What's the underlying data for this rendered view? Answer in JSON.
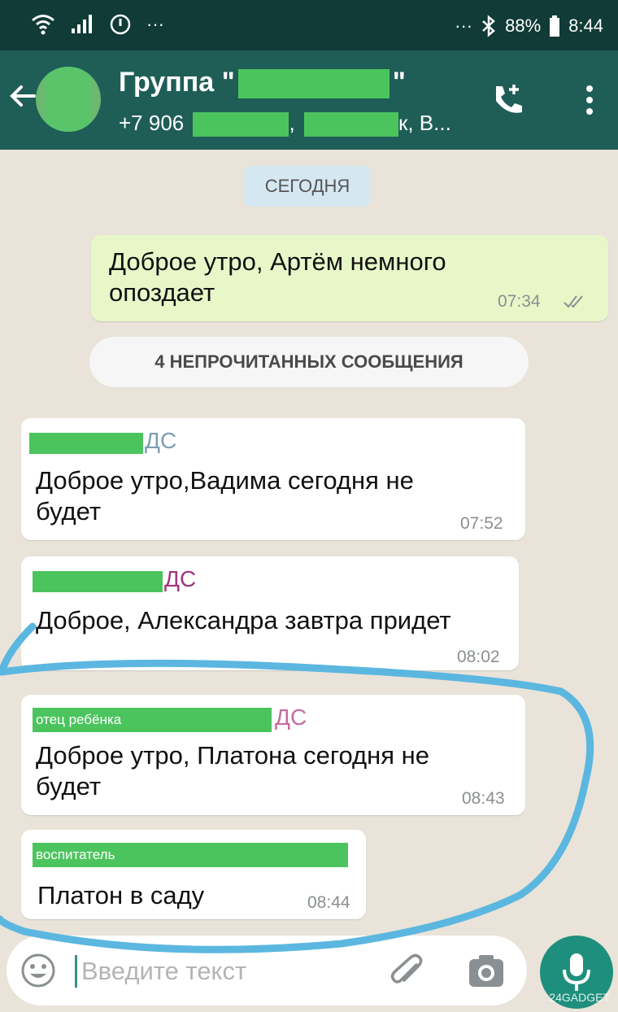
{
  "statusbar": {
    "battery": "88%",
    "time": "8:44",
    "icons": [
      "wifi-icon",
      "signal-icon",
      "sync-icon",
      "more-icon",
      "bluetooth-icon",
      "battery-icon"
    ],
    "left_dots": "···",
    "right_dots": "···"
  },
  "header": {
    "title_prefix": "Группа \"",
    "title_suffix": "\"",
    "subtitle_prefix": "+7 906",
    "subtitle_mid": ",",
    "subtitle_suffix": "к, В..."
  },
  "chat": {
    "date_chip": "СЕГОДНЯ",
    "unread_chip": "4 НЕПРОЧИТАННЫХ СООБЩЕНИЯ",
    "messages": [
      {
        "direction": "out",
        "sender": "",
        "tag": "",
        "text_lines": [
          "Доброе утро, Артём немного",
          "опоздает"
        ],
        "time": "07:34",
        "read_status": "read"
      },
      {
        "direction": "in",
        "sender": "ДС",
        "tag": "",
        "text_lines": [
          "Доброе утро,Вадима сегодня не",
          "будет"
        ],
        "time": "07:52"
      },
      {
        "direction": "in",
        "sender": "ДС",
        "tag": "",
        "text_lines": [
          "Доброе, Александра завтра придет"
        ],
        "time": "08:02"
      },
      {
        "direction": "in",
        "sender": "ДС",
        "tag": "отец ребёнка",
        "text_lines": [
          "Доброе утро, Платона сегодня не",
          "будет"
        ],
        "time": "08:43"
      },
      {
        "direction": "in",
        "sender": "",
        "tag": "воспитатель",
        "text_lines": [
          "Платон в саду"
        ],
        "time": "08:44"
      }
    ]
  },
  "composer": {
    "placeholder": "Введите текст"
  },
  "watermark": "24GADGET",
  "colors": {
    "statusbar": "#103b36",
    "appbar": "#1f5e57",
    "outgoing_bubble": "#e7f7c8",
    "redaction": "#4cc45e",
    "highlight_loop": "#5bb7e0",
    "mic_button": "#1f8f7d"
  }
}
